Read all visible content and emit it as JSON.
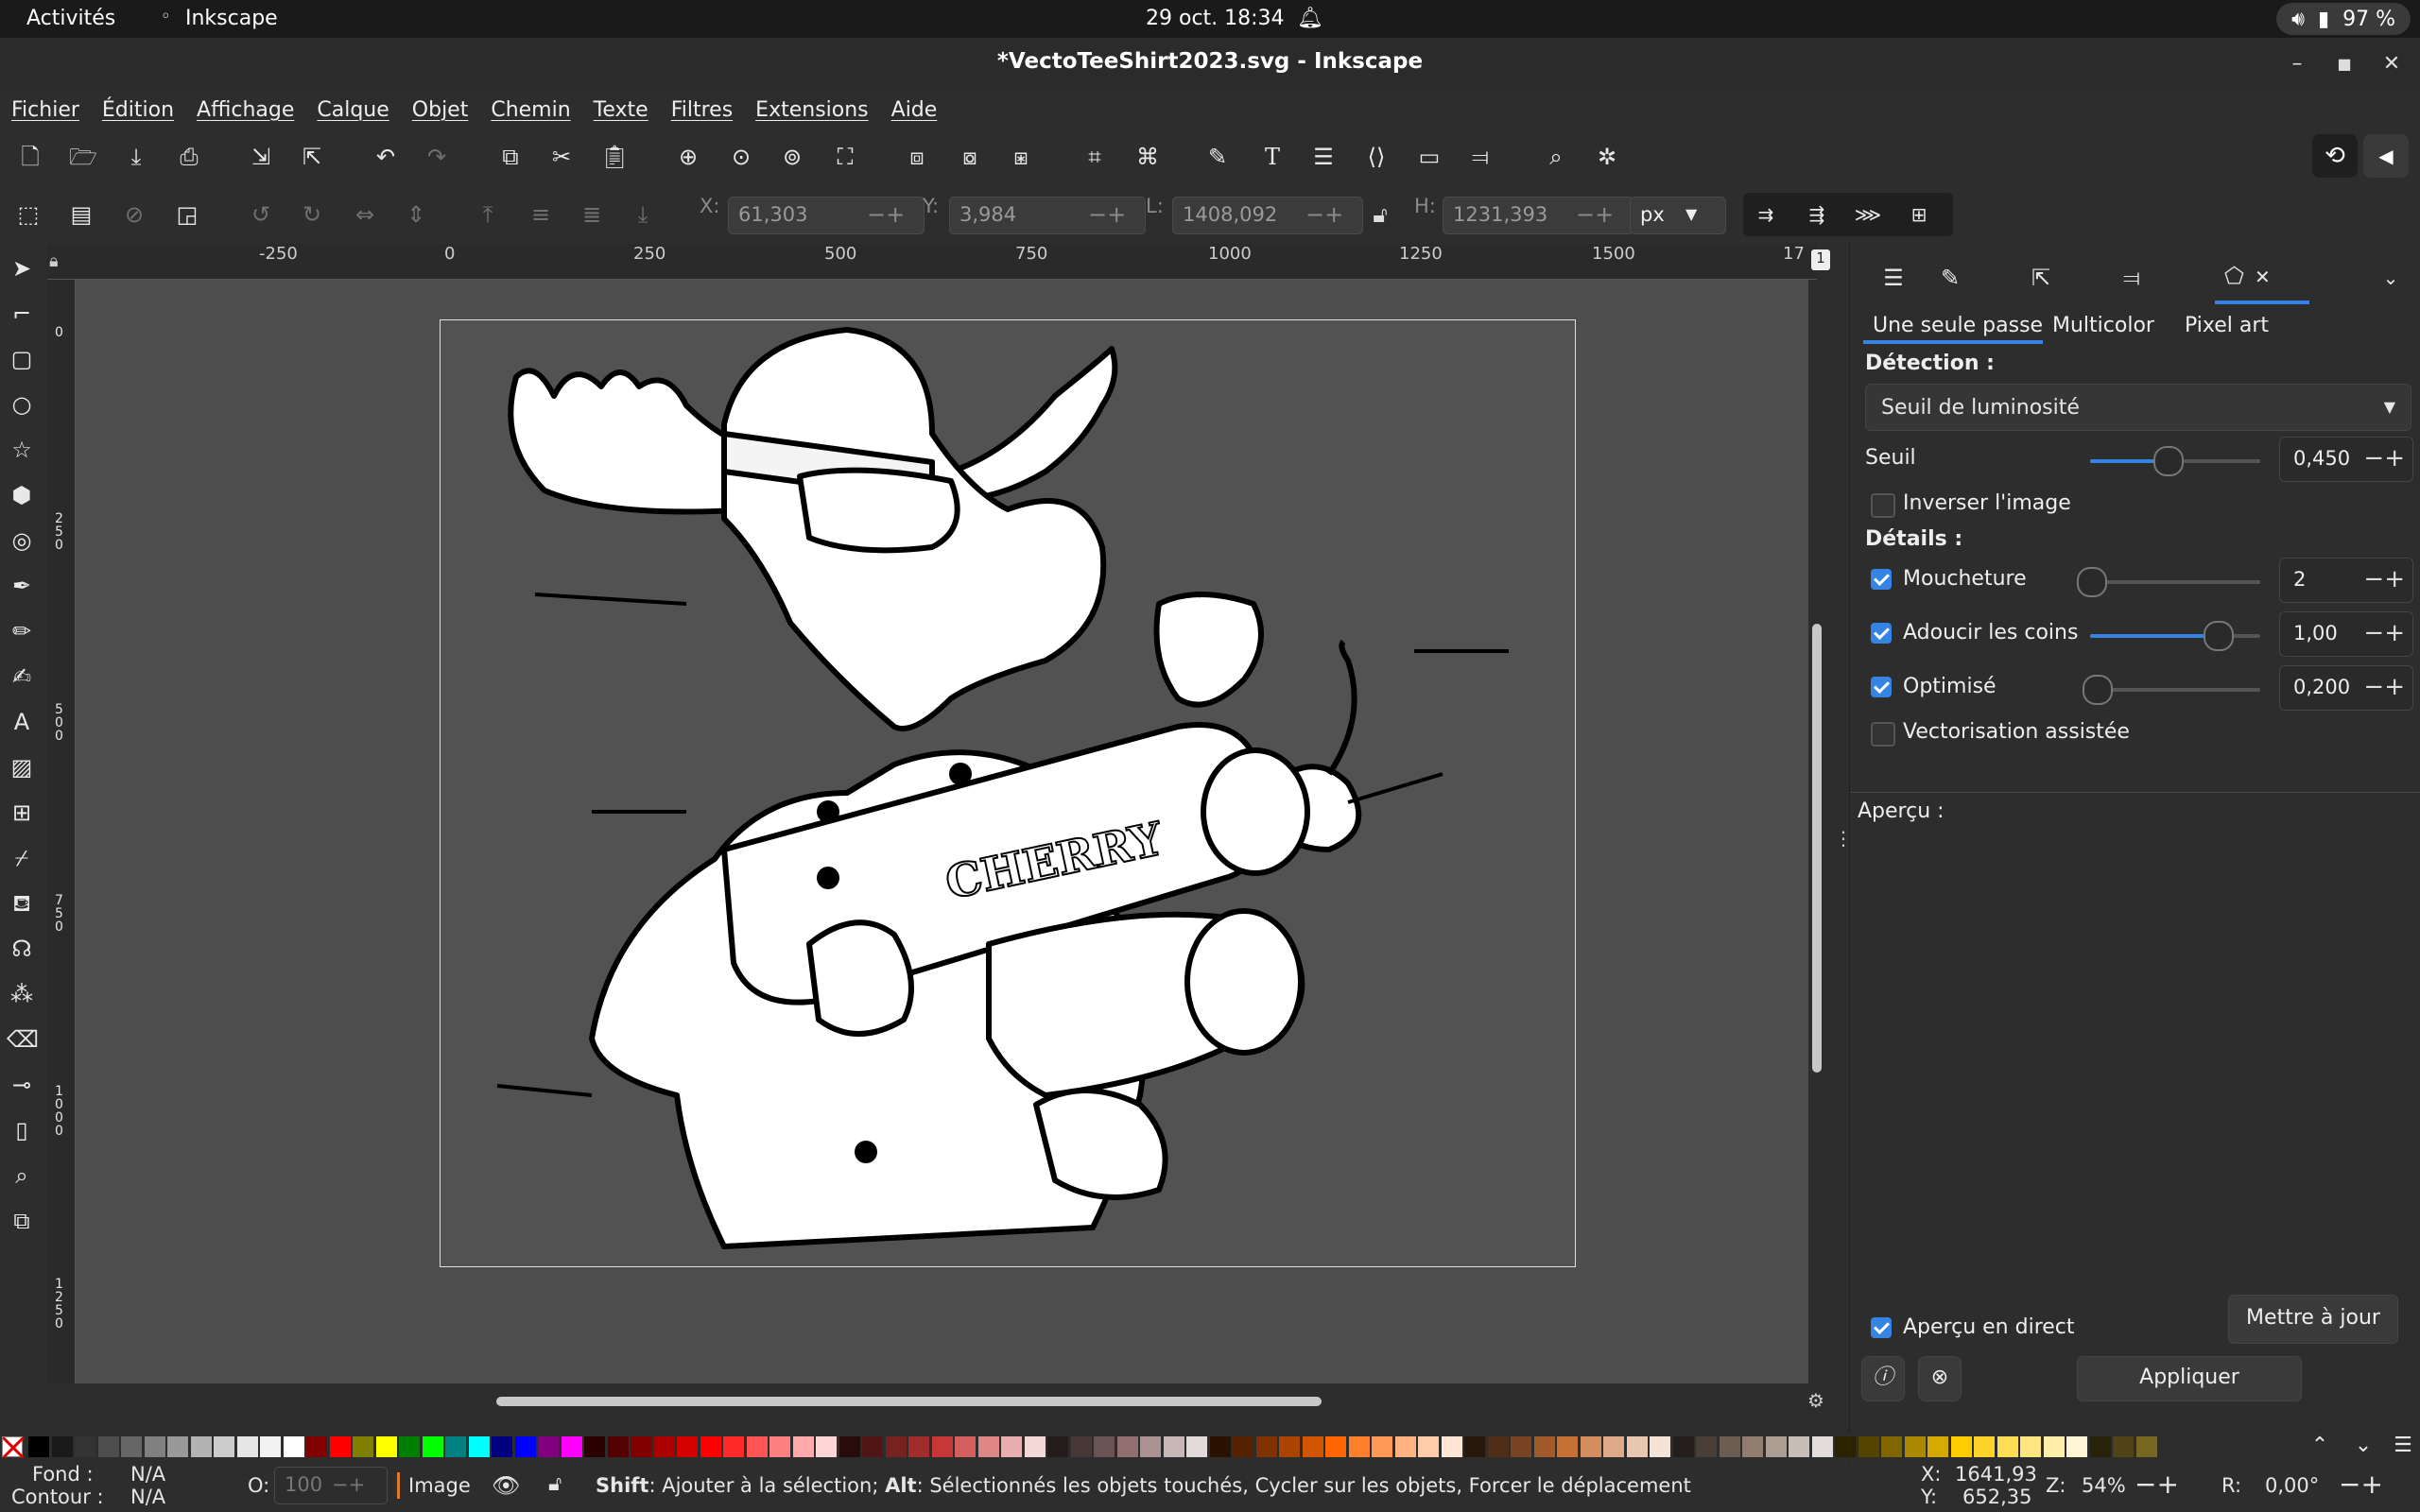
{
  "system": {
    "activities": "Activités",
    "app_name": "Inkscape",
    "clock": "29 oct.  18:34",
    "battery": "97 %"
  },
  "window": {
    "title": "*VectoTeeShirt2023.svg - Inkscape"
  },
  "menu": [
    "Fichier",
    "Édition",
    "Affichage",
    "Calque",
    "Objet",
    "Chemin",
    "Texte",
    "Filtres",
    "Extensions",
    "Aide"
  ],
  "selectbar": {
    "x_label": "X:",
    "x_value": "61,303",
    "y_label": "Y:",
    "y_value": "3,984",
    "w_label": "L:",
    "w_value": "1408,092",
    "h_label": "H:",
    "h_value": "1231,393",
    "unit": "px"
  },
  "ruler": {
    "h_ticks": [
      "-250",
      "0",
      "250",
      "500",
      "750",
      "1000",
      "1250",
      "1500",
      "17"
    ],
    "v_ticks": [
      "0",
      "250",
      "500",
      "750",
      "1000",
      "1250"
    ],
    "page_badge": "1"
  },
  "canvas": {
    "art_text": "CHERRY"
  },
  "panel": {
    "tabs": [
      "Une seule passe",
      "Multicolor",
      "Pixel art"
    ],
    "detection_label": "Détection :",
    "detection_mode": "Seuil de luminosité",
    "threshold_label": "Seuil",
    "threshold_value": "0,450",
    "threshold_level": 0.45,
    "invert_label": "Inverser l'image",
    "invert_checked": false,
    "details_label": "Détails :",
    "speckles_label": "Moucheture",
    "speckles_value": "2",
    "speckles_checked": true,
    "smooth_label": "Adoucir les coins",
    "smooth_value": "1,00",
    "smooth_checked": true,
    "optimize_label": "Optimisé",
    "optimize_value": "0,200",
    "optimize_checked": true,
    "assisted_label": "Vectorisation assistée",
    "assisted_checked": false,
    "preview_label": "Aperçu :",
    "live_preview_label": "Aperçu en direct",
    "live_preview_checked": true,
    "update_button": "Mettre à jour",
    "apply_button": "Appliquer"
  },
  "palette": {
    "colors": [
      "#000000",
      "#1a1a1a",
      "#333333",
      "#4d4d4d",
      "#666666",
      "#808080",
      "#999999",
      "#b3b3b3",
      "#cccccc",
      "#e6e6e6",
      "#f2f2f2",
      "#ffffff",
      "#800000",
      "#ff0000",
      "#808000",
      "#ffff00",
      "#008000",
      "#00ff00",
      "#008080",
      "#00ffff",
      "#000080",
      "#0000ff",
      "#800080",
      "#ff00ff",
      "#2b0000",
      "#550000",
      "#800000",
      "#aa0000",
      "#d40000",
      "#ff0000",
      "#ff2a2a",
      "#ff5555",
      "#ff8080",
      "#ffaaaa",
      "#ffd5d5",
      "#280b0b",
      "#501616",
      "#782121",
      "#a02c2c",
      "#c83737",
      "#d35f5f",
      "#de8787",
      "#e9afaf",
      "#f4d7d7",
      "#241c1c",
      "#483737",
      "#6c5353",
      "#916f6f",
      "#ac9393",
      "#c8b7b7",
      "#e3dbdb",
      "#2b1100",
      "#552200",
      "#803300",
      "#aa4400",
      "#d45500",
      "#ff6600",
      "#ff7f2a",
      "#ff9955",
      "#ffb380",
      "#ffccaa",
      "#ffe6d5",
      "#28170b",
      "#502d16",
      "#784421",
      "#a05a2c",
      "#c87137",
      "#d38d5f",
      "#deaa87",
      "#e9c6af",
      "#f4e3d7",
      "#241f1c",
      "#483e37",
      "#6c5d53",
      "#917c6f",
      "#ac9d93",
      "#c8beb7",
      "#e3dedb",
      "#2b2200",
      "#554400",
      "#806600",
      "#aa8800",
      "#d4aa00",
      "#ffcc00",
      "#ffd42a",
      "#ffdd55",
      "#ffe680",
      "#ffeeaa",
      "#fff6d5",
      "#28220b",
      "#504416",
      "#786721"
    ]
  },
  "status": {
    "fill_label": "Fond :",
    "fill_value": "N/A",
    "stroke_label": "Contour :",
    "stroke_value": "N/A",
    "opacity_label": "O:",
    "opacity_value": "100",
    "layer_name": "Image",
    "message_key1": "Shift",
    "message_part1": ": Ajouter à la sélection; ",
    "message_key2": "Alt",
    "message_part2": ": Sélectionnés les objets touchés, Cycler sur les objets, Forcer le déplacement",
    "cursor_x_label": "X:",
    "cursor_x": "1641,93",
    "cursor_y_label": "Y:",
    "cursor_y": "652,35",
    "zoom_label": "Z:",
    "zoom_value": "54%",
    "rotation_label": "R:",
    "rotation_value": "0,00°"
  }
}
